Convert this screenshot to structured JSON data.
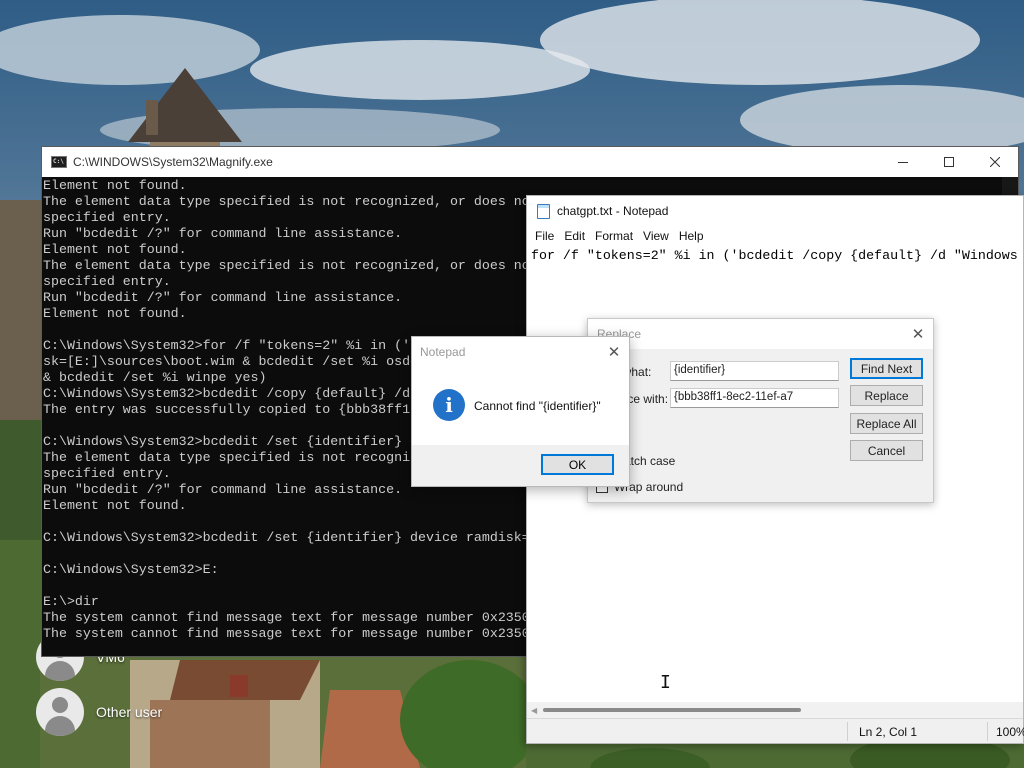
{
  "desktop": {
    "users": [
      {
        "name": "VM6"
      },
      {
        "name": "Other user"
      }
    ]
  },
  "console": {
    "title": "C:\\WINDOWS\\System32\\Magnify.exe",
    "lines": [
      "Element not found.",
      "The element data type specified is not recognized, or does not apply to the",
      "specified entry.",
      "Run \"bcdedit /?\" for command line assistance.",
      "Element not found.",
      "The element data type specified is not recognized, or does not apply to the",
      "specified entry.",
      "Run \"bcdedit /?\" for command line assistance.",
      "Element not found.",
      "",
      "C:\\Windows\\System32>for /f \"tokens=2\" %i in ('bcdedit /copy {default} /d \"Windows",
      "sk=[E:]\\sources\\boot.wim & bcdedit /set %i osdevice ramdisk=[E:]\\sources\\boot.wim,{7619dcc8-fafe",
      "& bcdedit /set %i winpe yes)",
      "C:\\Windows\\System32>bcdedit /copy {default} /d \"Windows PE\"",
      "The entry was successfully copied to {bbb38ff1-8ec2-11ef-a7",
      "",
      "C:\\Windows\\System32>bcdedit /set {identifier} device ramdisk",
      "The element data type specified is not recognized, or does not apply to the",
      "specified entry.",
      "Run \"bcdedit /?\" for command line assistance.",
      "Element not found.",
      "",
      "C:\\Windows\\System32>bcdedit /set {identifier} device ramdisk=[E:]\\sources\\boot.wim",
      "",
      "C:\\Windows\\System32>E:",
      "",
      "E:\\>dir",
      "The system cannot find message text for message number 0x2350",
      "The system cannot find message text for message number 0x2350"
    ]
  },
  "notepad": {
    "title": "chatgpt.txt - Notepad",
    "menu": [
      "File",
      "Edit",
      "Format",
      "View",
      "Help"
    ],
    "content": "for /f \"tokens=2\" %i in ('bcdedit /copy {default} /d \"Windows",
    "status_position": "Ln 2, Col 1",
    "status_zoom": "100%"
  },
  "replace_dialog": {
    "title": "Replace",
    "find_label": "Find what:",
    "find_value": "{identifier}",
    "replace_label": "Replace with:",
    "replace_value": "{bbb38ff1-8ec2-11ef-a7",
    "match_case_label": "Match case",
    "wrap_around_label": "Wrap around",
    "buttons": {
      "find_next": "Find Next",
      "replace": "Replace",
      "replace_all": "Replace All",
      "cancel": "Cancel"
    }
  },
  "message_box": {
    "title": "Notepad",
    "message": "Cannot find \"{identifier}\"",
    "ok_label": "OK",
    "icon": "info-icon"
  }
}
